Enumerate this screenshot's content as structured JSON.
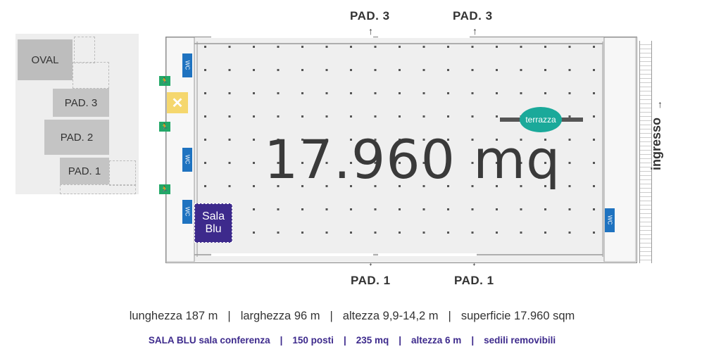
{
  "mini_map": {
    "oval": "OVAL",
    "pad3": "PAD. 3",
    "pad2": "PAD. 2",
    "pad1": "PAD. 1"
  },
  "hall": {
    "area_label": "17.960 mq",
    "top_left_label": "PAD. 3",
    "top_right_label": "PAD. 3",
    "bottom_left_label": "PAD. 1",
    "bottom_right_label": "PAD. 1",
    "terrazza": "terrazza",
    "sala_blu_line1": "Sala",
    "sala_blu_line2": "Blu",
    "ingresso": "ingresso"
  },
  "specs": {
    "length": "lunghezza 187 m",
    "width": "larghezza 96 m",
    "height": "altezza 9,9-14,2 m",
    "surface": "superficie  17.960 sqm"
  },
  "sala_specs": {
    "name": "SALA BLU sala conferenza",
    "seats": "150 posti",
    "area": "235 mq",
    "height": "altezza 6 m",
    "seating": "sedili removibili"
  },
  "colors": {
    "accent_purple": "#3d2a8c",
    "terrazza_teal": "#1aa99a",
    "exit_green": "#22a867",
    "wc_blue": "#1f73c0",
    "food_yellow": "#f5d76e"
  }
}
